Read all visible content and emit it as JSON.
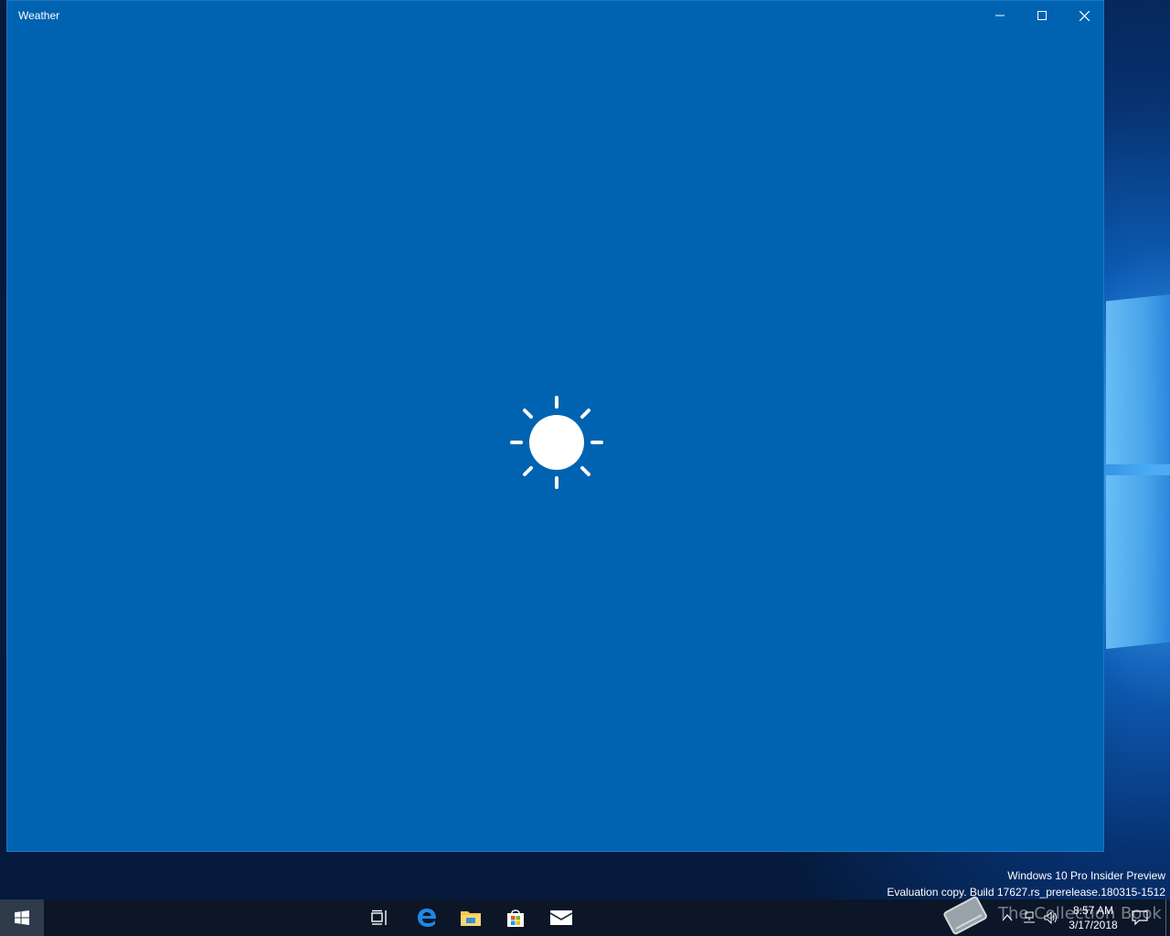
{
  "window": {
    "title": "Weather",
    "background_color": "#0063b1",
    "controls": {
      "minimize": "minimize-icon",
      "maximize": "maximize-icon",
      "close": "close-icon"
    },
    "splash_icon": "sun-icon"
  },
  "desktop": {
    "watermark_line1": "Windows 10 Pro Insider Preview",
    "watermark_line2": "Evaluation copy. Build 17627.rs_prerelease.180315-1512"
  },
  "taskbar": {
    "pinned": [
      "start-icon",
      "task-view-icon",
      "edge-icon",
      "file-explorer-icon",
      "store-icon",
      "mail-icon"
    ],
    "tray_overlay_text": "The Collection Book",
    "clock_time": "8:57 AM",
    "clock_date": "3/17/2018"
  }
}
